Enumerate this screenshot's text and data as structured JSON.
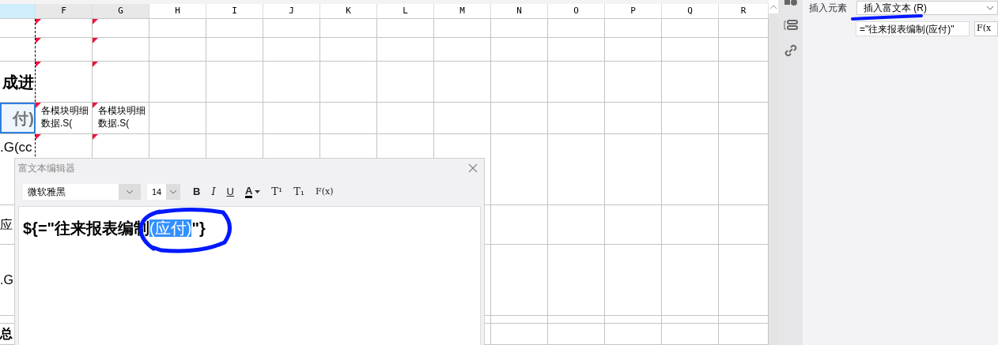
{
  "sheet": {
    "columns": [
      {
        "selected": true
      },
      {
        "label": "F",
        "selected": false
      },
      {
        "label": "G",
        "selected": false
      },
      {
        "label": "H",
        "selected": false
      },
      {
        "label": "I",
        "selected": false
      },
      {
        "label": "J",
        "selected": false
      },
      {
        "label": "K",
        "selected": false
      },
      {
        "label": "L",
        "selected": false
      },
      {
        "label": "M",
        "selected": false
      },
      {
        "label": "N",
        "selected": false
      },
      {
        "label": "O",
        "selected": false
      },
      {
        "label": "P",
        "selected": false
      },
      {
        "label": "Q",
        "selected": false
      },
      {
        "label": "R",
        "selected": false
      }
    ],
    "rows": [
      {
        "cells": [
          "",
          "",
          ""
        ],
        "selected": false
      },
      {
        "cells": [
          "",
          "",
          ""
        ],
        "selected": false
      },
      {
        "cells": [
          "成进",
          "",
          ""
        ],
        "selected": false
      },
      {
        "cells": [
          "付)",
          "各模块明细数据.S(",
          "各模块明细数据.S("
        ],
        "selected": true
      },
      {
        "cells": [
          ".G(cc",
          "",
          ""
        ],
        "selected": false
      },
      {
        "cells": [
          "应",
          "",
          ""
        ],
        "selected": false
      },
      {
        "cells": [
          ".G",
          "",
          ""
        ],
        "selected": false
      },
      {
        "cells": [
          "",
          "",
          ""
        ],
        "selected": false
      },
      {
        "cells": [
          "总",
          "",
          ""
        ],
        "selected": false
      }
    ]
  },
  "dialog": {
    "title": "富文本编辑器",
    "font": "微软雅黑",
    "size": "14",
    "tools": [
      {
        "kind": "bold",
        "label": "B"
      },
      {
        "kind": "italic",
        "label": "I"
      },
      {
        "kind": "underline",
        "label": "U"
      },
      {
        "kind": "color",
        "label": "A"
      },
      {
        "kind": "sup",
        "label": "T¹"
      },
      {
        "kind": "sub",
        "label": "T₁"
      },
      {
        "kind": "formula",
        "label": "F(x)"
      }
    ],
    "content": [
      {
        "text": "${=\"往来报表编制",
        "selected": false
      },
      {
        "text": "(应付)",
        "selected": true
      },
      {
        "text": "\"}",
        "selected": false
      }
    ]
  },
  "panel": {
    "label": "插入元素",
    "select": "插入富文本 (R)",
    "formula": "=\"往来报表编制(应付)\"",
    "formula_button": "F(x"
  }
}
